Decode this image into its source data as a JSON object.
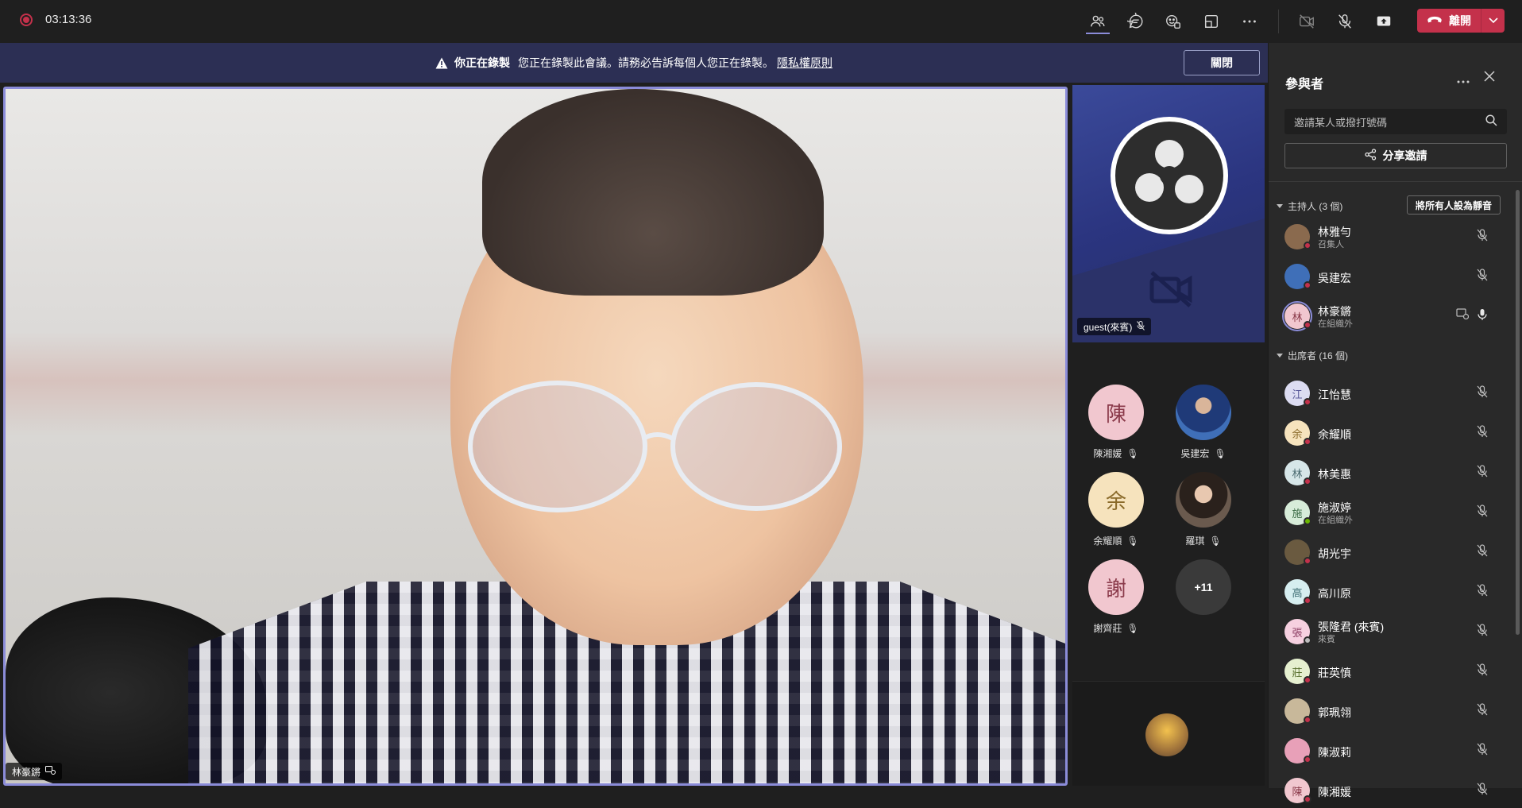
{
  "top_bar": {
    "timer": "03:13:36",
    "leave_label": "離開"
  },
  "banner": {
    "title": "你正在錄製",
    "message": "您正在錄製此會議。請務必告訴每個人您正在錄製。",
    "link": "隱私權原則",
    "close_label": "關閉"
  },
  "main_video": {
    "name": "林豪鏘"
  },
  "side_tiles": {
    "guest_name": "guest(來賓)",
    "avatars": [
      {
        "initial": "陳",
        "name": "陳湘媛",
        "bg": "#f1c7cf",
        "fg": "#8a3a4a"
      },
      {
        "initial": "",
        "name": "吳建宏",
        "bg": "#3f6fb8",
        "fg": "#ffffff"
      },
      {
        "initial": "余",
        "name": "余耀順",
        "bg": "#f6e3bd",
        "fg": "#8a6a2a"
      },
      {
        "initial": "",
        "name": "羅琪",
        "bg": "#6a5a4e",
        "fg": "#ffffff"
      },
      {
        "initial": "謝",
        "name": "謝齊莊",
        "bg": "#f1c7cf",
        "fg": "#8a3a4a"
      }
    ],
    "more_count": "+11"
  },
  "panel": {
    "title": "參與者",
    "search_placeholder": "邀請某人或撥打號碼",
    "share_label": "分享邀請",
    "hosts_label": "主持人 (3 個)",
    "mute_all_label": "將所有人設為靜音",
    "attendees_label": "出席者 (16 個)",
    "hosts": [
      {
        "initial": "",
        "name": "林雅勻",
        "sub": "召集人",
        "bg": "#8a6a4e",
        "fg": "#fff",
        "status": "red"
      },
      {
        "initial": "",
        "name": "吳建宏",
        "sub": "",
        "bg": "#3f6fb8",
        "fg": "#fff",
        "status": "red"
      },
      {
        "initial": "林",
        "name": "林豪鏘",
        "sub": "在組織外",
        "bg": "#f1c7cf",
        "fg": "#8a3a4a",
        "status": "red"
      }
    ],
    "attendees": [
      {
        "initial": "江",
        "name": "江怡慧",
        "sub": "",
        "bg": "#dcdcf2",
        "fg": "#5a5a9a",
        "status": "red"
      },
      {
        "initial": "余",
        "name": "余耀順",
        "sub": "",
        "bg": "#f6e3bd",
        "fg": "#8a6a2a",
        "status": "red"
      },
      {
        "initial": "林",
        "name": "林美惠",
        "sub": "",
        "bg": "#d6e6e8",
        "fg": "#4a6a70",
        "status": "red"
      },
      {
        "initial": "施",
        "name": "施淑婷",
        "sub": "在組織外",
        "bg": "#d7ecd9",
        "fg": "#3a6a44",
        "status": "green"
      },
      {
        "initial": "",
        "name": "胡光宇",
        "sub": "",
        "bg": "#6a5a40",
        "fg": "#fff",
        "status": "red"
      },
      {
        "initial": "高",
        "name": "高川原",
        "sub": "",
        "bg": "#d6eef0",
        "fg": "#3a6a70",
        "status": "red"
      },
      {
        "initial": "張",
        "name": "張隆君 (來賓)",
        "sub": "來賓",
        "bg": "#f6d0e0",
        "fg": "#8a3a60",
        "status": "grey"
      },
      {
        "initial": "莊",
        "name": "莊英慎",
        "sub": "",
        "bg": "#e6f0d0",
        "fg": "#5a7030",
        "status": "red"
      },
      {
        "initial": "",
        "name": "郭珮翎",
        "sub": "",
        "bg": "#c8b89a",
        "fg": "#fff",
        "status": "red"
      },
      {
        "initial": "",
        "name": "陳淑莉",
        "sub": "",
        "bg": "#e8a0b8",
        "fg": "#fff",
        "status": "red"
      },
      {
        "initial": "陳",
        "name": "陳湘媛",
        "sub": "",
        "bg": "#f1c7cf",
        "fg": "#8a3a4a",
        "status": "red"
      }
    ]
  },
  "colors": {
    "accent": "#8b8cd9",
    "leave": "#c4314b",
    "banner": "#2c2f54"
  }
}
